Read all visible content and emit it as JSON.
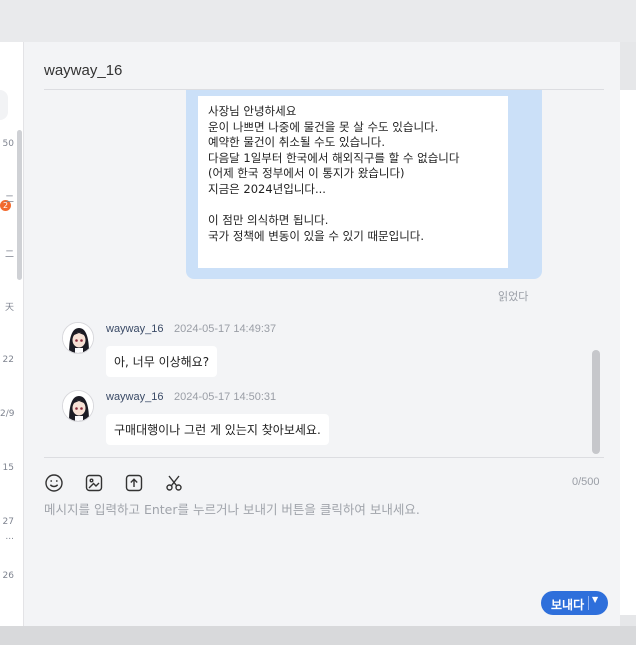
{
  "chat": {
    "title": "wayway_16",
    "outgoing": {
      "lines": [
        "사장님 안녕하세요",
        "운이 나쁘면 나중에 물건을 못 살 수도 있습니다.",
        "예약한 물건이 취소될 수도 있습니다.",
        "다음달 1일부터 한국에서 해외직구를 할 수 없습니다",
        "(어제 한국 정부에서 이 통지가 왔습니다)",
        "지금은 2024년입니다...",
        "",
        "이 점만 의식하면 됩니다.",
        "국가 정책에 변동이 있을 수 있기 때문입니다."
      ],
      "status": "읽었다"
    },
    "incoming": [
      {
        "sender": "wayway_16",
        "time": "2024-05-17 14:49:37",
        "text": "아, 너무 이상해요?"
      },
      {
        "sender": "wayway_16",
        "time": "2024-05-17 14:50:31",
        "text": "구매대행이나 그런 게 있는지 찾아보세요."
      }
    ]
  },
  "composer": {
    "counter": "0/500",
    "placeholder": "메시지를 입력하고 Enter를 누르거나 보내기 버튼을 클릭하여 보내세요.",
    "send_label": "보내다",
    "send_caret": "▼",
    "tools": [
      "emoji-icon",
      "image-icon",
      "upload-icon",
      "scissors-icon"
    ]
  },
  "left_list": {
    "fragments": [
      "50",
      "2",
      "二",
      "二",
      "天",
      "22",
      "2/9",
      "15",
      "27",
      "...",
      "26"
    ]
  },
  "colors": {
    "accent": "#2e6fdb",
    "outgoing_bubble": "#cbe0f8",
    "badge": "#f26a2e"
  }
}
